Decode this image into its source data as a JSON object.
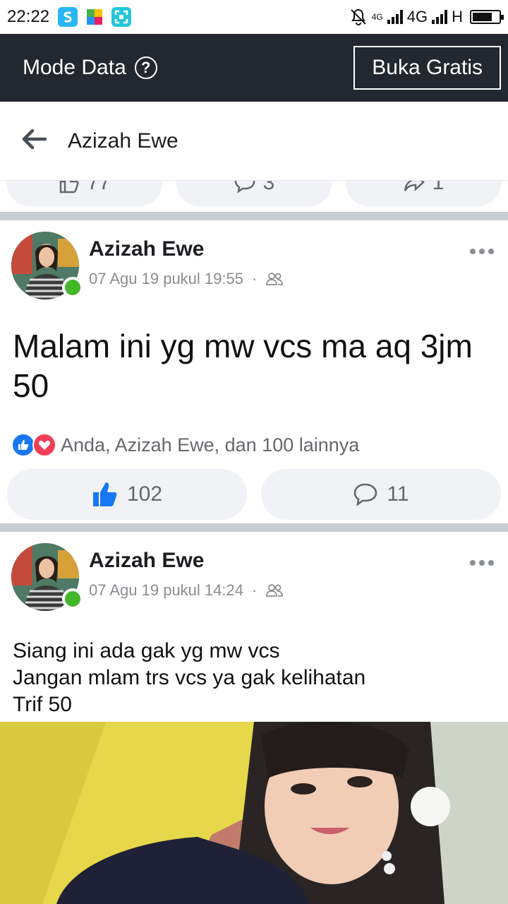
{
  "status_bar": {
    "time": "22:22",
    "network_1": "4G",
    "network_2": "4G",
    "network_3": "H",
    "battery_level": 0.75
  },
  "data_mode_bar": {
    "label": "Mode Data",
    "help_icon": "?",
    "open_free_button": "Buka Gratis"
  },
  "header": {
    "back_icon": "arrow-left-icon",
    "title": "Azizah Ewe"
  },
  "previous_post_actions": {
    "like_count": "77",
    "comment_count": "3",
    "share_count": "1"
  },
  "posts": [
    {
      "author": "Azizah Ewe",
      "timestamp": "07 Agu 19 pukul 19:55",
      "separator": "·",
      "audience_icon": "friends-icon",
      "text": "Malam ini yg mw vcs ma aq 3jm 50",
      "reactions_summary": "Anda, Azizah Ewe, dan 100 lainnya",
      "like_count": "102",
      "comment_count": "11"
    },
    {
      "author": "Azizah Ewe",
      "timestamp": "07 Agu 19 pukul 14:24",
      "separator": "·",
      "audience_icon": "friends-icon",
      "text": "Siang ini ada gak yg mw vcs\nJangan  mlam trs vcs ya gak kelihatan\nTrif 50"
    }
  ],
  "colors": {
    "mode_bar_bg": "#222730",
    "facebook_blue": "#1877f2",
    "love_red": "#f33e58",
    "online_green": "#42b72a",
    "separator_gray": "#c9ccd1"
  }
}
